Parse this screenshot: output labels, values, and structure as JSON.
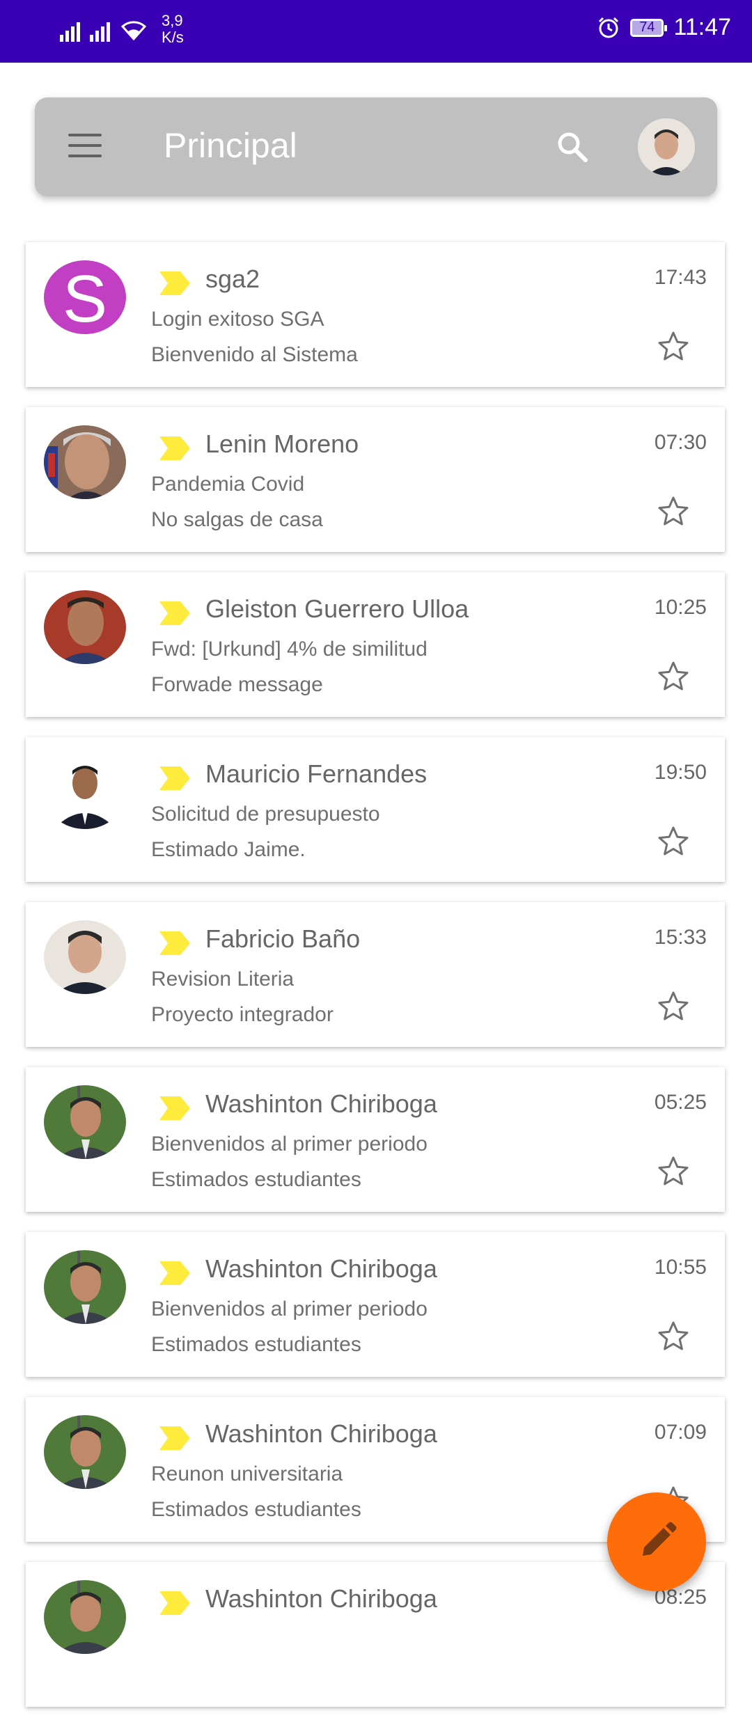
{
  "status_bar": {
    "net_speed_value": "3,9",
    "net_speed_unit": "K/s",
    "battery": "74",
    "time": "11:47"
  },
  "app_bar": {
    "title": "Principal",
    "icons": [
      "menu-icon",
      "search-icon",
      "avatar"
    ]
  },
  "colors": {
    "status_bar": "#3a00b3",
    "app_bar": "#c0c0c0",
    "tag": "#ffeb3b",
    "fab": "#ff6d0a",
    "sga_avatar": "#c23fc4"
  },
  "emails": [
    {
      "sender": "sga2",
      "subject": "Login exitoso SGA",
      "preview": "Bienvenido al Sistema",
      "time": "17:43",
      "avatar_letter": "S"
    },
    {
      "sender": "Lenin Moreno",
      "subject": "Pandemia Covid",
      "preview": "No salgas de casa",
      "time": "07:30"
    },
    {
      "sender": "Gleiston Guerrero Ulloa",
      "subject": "Fwd: [Urkund] 4% de similitud",
      "preview": "Forwade message",
      "time": "10:25"
    },
    {
      "sender": "Mauricio Fernandes",
      "subject": "Solicitud de presupuesto",
      "preview": "Estimado Jaime.",
      "time": "19:50"
    },
    {
      "sender": "Fabricio Baño",
      "subject": "Revision Literia",
      "preview": "Proyecto integrador",
      "time": "15:33"
    },
    {
      "sender": "Washinton Chiriboga",
      "subject": "Bienvenidos al primer periodo",
      "preview": "Estimados estudiantes",
      "time": "05:25"
    },
    {
      "sender": "Washinton Chiriboga",
      "subject": "Bienvenidos al primer periodo",
      "preview": "Estimados estudiantes",
      "time": "10:55"
    },
    {
      "sender": "Washinton Chiriboga",
      "subject": "Reunon universitaria",
      "preview": "Estimados estudiantes",
      "time": "07:09"
    },
    {
      "sender": "Washinton Chiriboga",
      "subject": "",
      "preview": "",
      "time": "08:25"
    }
  ],
  "fab": {
    "icon": "edit-icon"
  }
}
